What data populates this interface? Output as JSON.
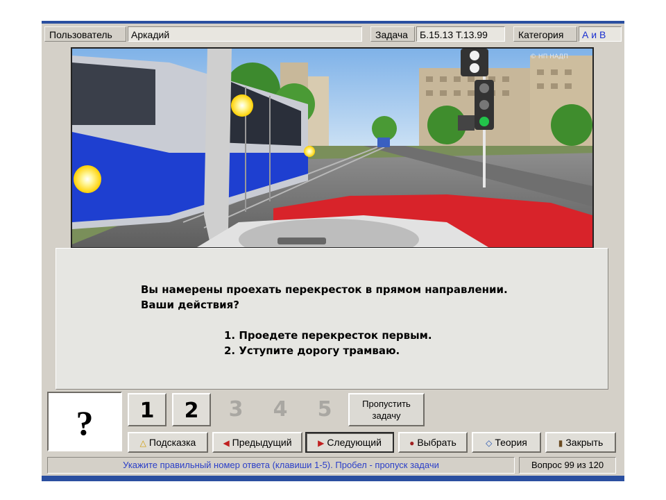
{
  "header": {
    "user_label": "Пользователь",
    "user_value": "Аркадий",
    "task_label": "Задача",
    "task_value": "Б.15.13  Т.13.99",
    "category_label": "Категория",
    "category_value": "А и В"
  },
  "scene": {
    "description_icon": "intersection-scene-illustration",
    "watermark": "© НП НАДП"
  },
  "question": {
    "lines": [
      "Вы намерены проехать перекресток в прямом направлении.",
      "Ваши действия?"
    ],
    "options": [
      "1. Проедете перекресток первым.",
      "2. Уступите дорогу трамваю."
    ]
  },
  "answer": {
    "placeholder_symbol": "?",
    "buttons": [
      "1",
      "2",
      "3",
      "4",
      "5"
    ],
    "skip_label_line1": "Пропустить",
    "skip_label_line2": "задачу"
  },
  "toolbar": {
    "hint": "Подсказка",
    "prev": "Предыдущий",
    "next": "Следующий",
    "choose": "Выбрать",
    "theory": "Теория",
    "close": "Закрыть"
  },
  "icons": {
    "hint": "lightbulb-icon",
    "prev": "arrow-left-icon",
    "next": "arrow-right-icon",
    "choose": "pointer-icon",
    "theory": "diamond-icon",
    "close": "door-exit-icon"
  },
  "status": {
    "message": "Укажите правильный номер ответа (клавиши 1-5). Пробел - пропуск задачи",
    "counter": "Вопрос 99 из 120"
  },
  "colors": {
    "frame_blue": "#2a4fa0",
    "window_gray": "#d4d0c8",
    "accent_text": "#2a3ec8"
  }
}
